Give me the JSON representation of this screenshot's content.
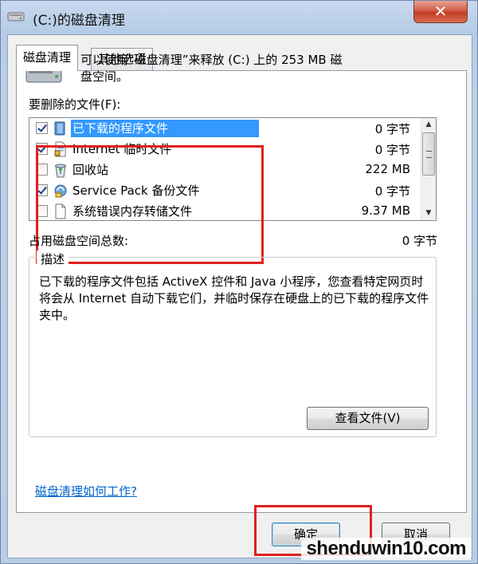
{
  "window": {
    "title": "(C:)的磁盘清理",
    "close_glyph": "✕"
  },
  "tabs": [
    {
      "label": "磁盘清理",
      "active": true
    },
    {
      "label": "其他选项",
      "active": false
    }
  ],
  "intro": {
    "line1": "可以使用“磁盘清理”来释放  (C:) 上的 253 MB 磁",
    "line2": "盘空间。"
  },
  "files_label": "要删除的文件(F):",
  "files": [
    {
      "name": "已下载的程序文件",
      "size": "0 字节",
      "checked": true,
      "selected": true,
      "icon": "folder-blue-icon"
    },
    {
      "name": "Internet 临时文件",
      "size": "0 字节",
      "checked": true,
      "selected": false,
      "icon": "document-lock-icon"
    },
    {
      "name": "回收站",
      "size": "222 MB",
      "checked": false,
      "selected": false,
      "icon": "recycle-bin-icon"
    },
    {
      "name": "Service Pack 备份文件",
      "size": "0 字节",
      "checked": true,
      "selected": false,
      "icon": "service-pack-icon"
    },
    {
      "name": "系统错误内存转储文件",
      "size": "9.37 MB",
      "checked": false,
      "selected": false,
      "icon": "blank-file-icon"
    }
  ],
  "total": {
    "label": "占用磁盘空间总数:",
    "value": "0 字节"
  },
  "description": {
    "title": "描述",
    "text": "已下载的程序文件包括 ActiveX 控件和 Java 小程序，您查看特定网页时将会从 Internet 自动下载它们，并临时保存在硬盘上的已下载的程序文件夹中。"
  },
  "buttons": {
    "view_files": "查看文件(V)",
    "ok": "确定",
    "cancel": "取消"
  },
  "help_link": "磁盘清理如何工作?",
  "watermark": "shenduwin10.com",
  "colors": {
    "highlight": "#e02020",
    "selection": "#3399ff",
    "link": "#0066cc"
  }
}
